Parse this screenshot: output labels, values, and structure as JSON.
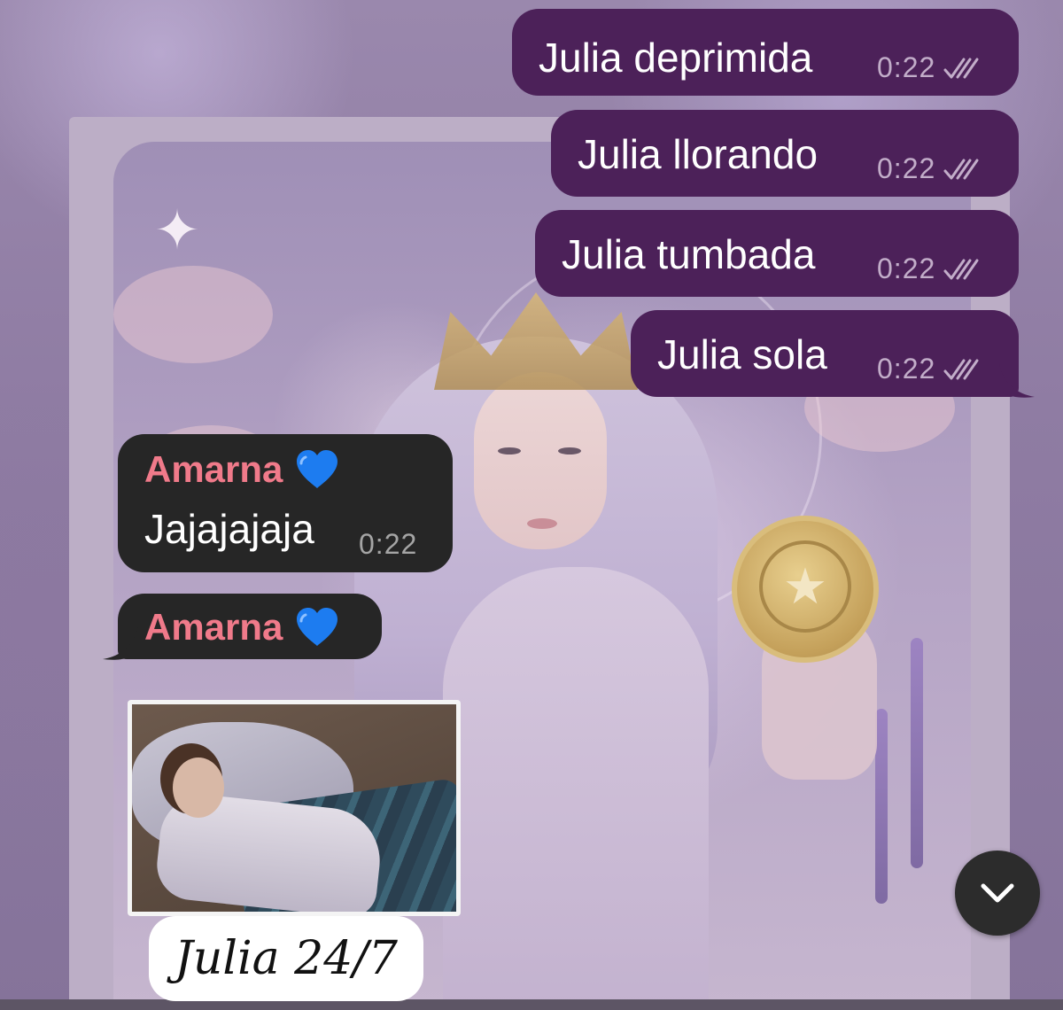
{
  "chat": {
    "outgoing": [
      {
        "text": "Julia deprimida",
        "time": "0:22",
        "status_icon": "double-check-icon"
      },
      {
        "text": "Julia llorando",
        "time": "0:22",
        "status_icon": "double-check-icon"
      },
      {
        "text": "Julia tumbada",
        "time": "0:22",
        "status_icon": "double-check-icon"
      },
      {
        "text": "Julia sola",
        "time": "0:22",
        "status_icon": "double-check-icon"
      }
    ],
    "incoming": [
      {
        "sender": "Amarna",
        "sender_emoji": "blue-heart-icon",
        "text": "Jajajajaja",
        "time": "0:22"
      },
      {
        "sender": "Amarna",
        "sender_emoji": "blue-heart-icon"
      }
    ],
    "sticker": {
      "caption": "Julia 24/7"
    }
  },
  "scroll_button": {
    "icon": "chevron-down-icon"
  },
  "colors": {
    "outgoing_bubble": "#4c2159",
    "incoming_bubble": "#262626",
    "sender_name": "#f07a8a",
    "heart": "#1d7cf0"
  }
}
